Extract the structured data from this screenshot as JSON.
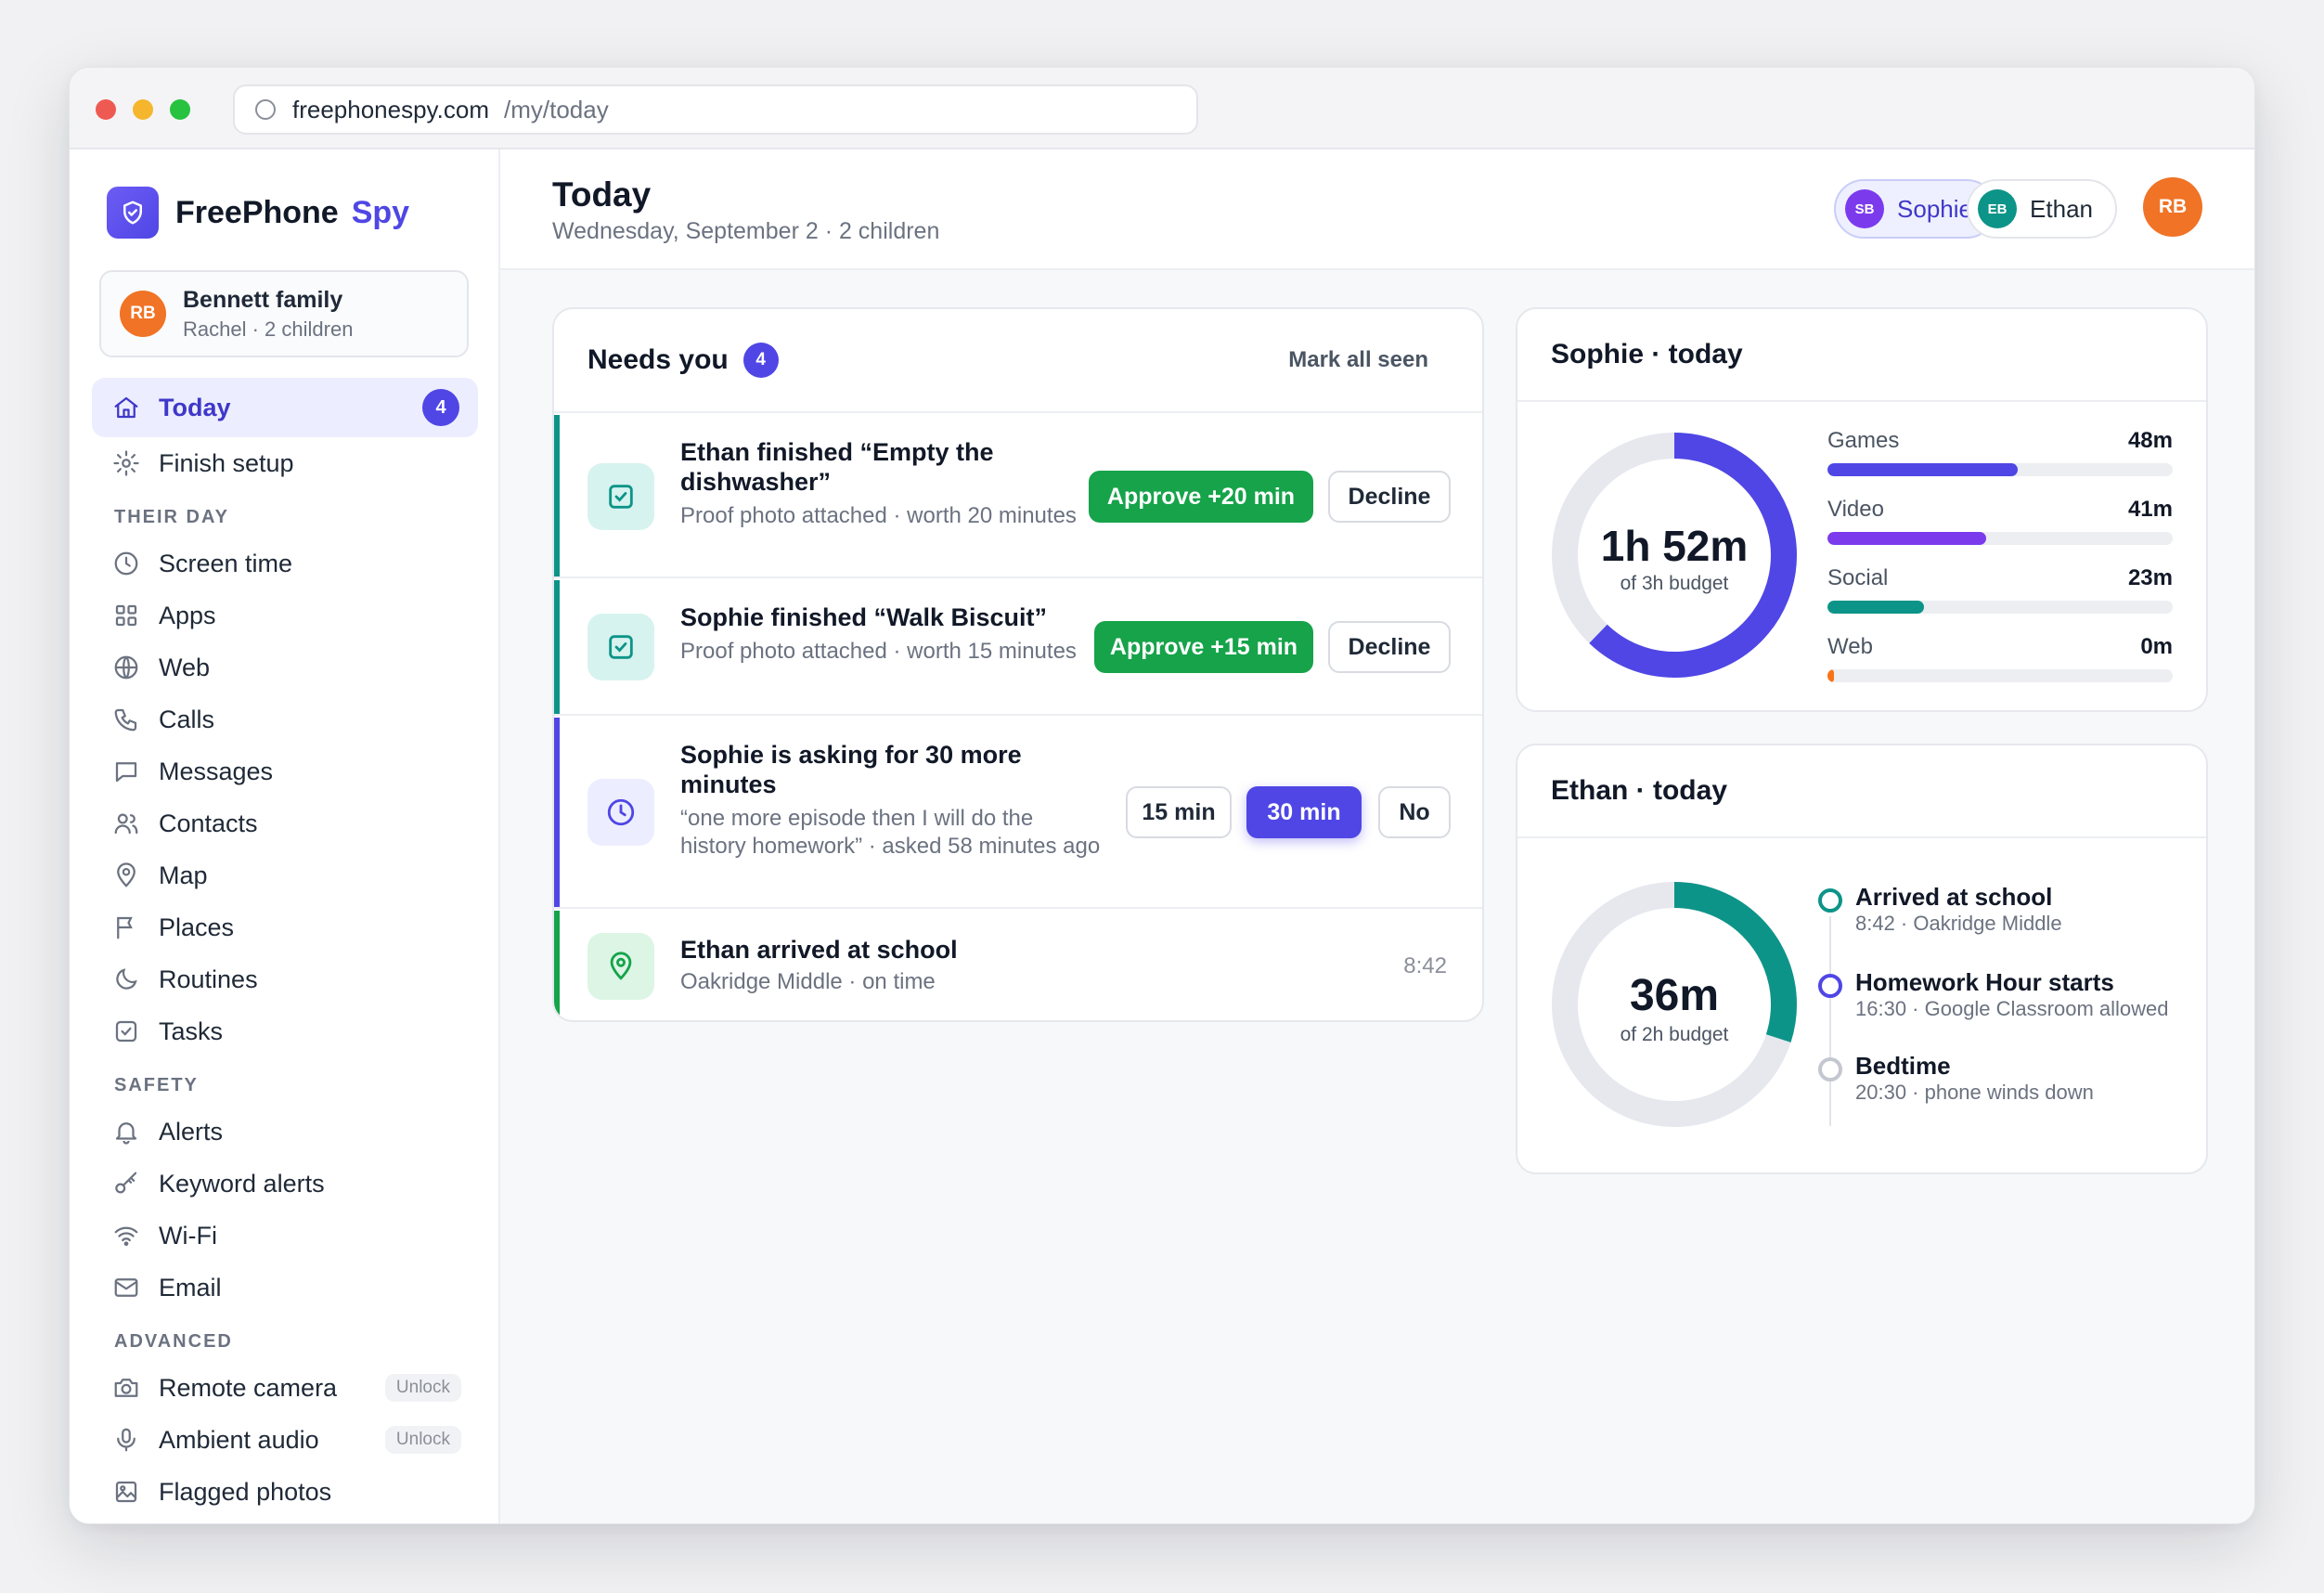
{
  "browser": {
    "host": "freephonespy.com",
    "path": "/my/today"
  },
  "brand": {
    "name": "FreePhone",
    "accent": "Spy"
  },
  "family": {
    "initials": "RB",
    "name": "Bennett family",
    "sub": "Rachel · 2 children"
  },
  "nav": {
    "today": {
      "label": "Today",
      "badge": "4"
    },
    "finish": {
      "label": "Finish setup"
    },
    "section_day": "THEIR DAY",
    "screen_time": "Screen time",
    "apps": "Apps",
    "web": "Web",
    "calls": "Calls",
    "messages": "Messages",
    "contacts": "Contacts",
    "map": "Map",
    "places": "Places",
    "routines": "Routines",
    "tasks": "Tasks",
    "section_safety": "SAFETY",
    "alerts": "Alerts",
    "keyword_alerts": "Keyword alerts",
    "wifi": "Wi-Fi",
    "email": "Email",
    "section_advanced": "ADVANCED",
    "remote_camera": "Remote camera",
    "ambient_audio": "Ambient audio",
    "flagged_photos": "Flagged photos",
    "unlock": "Unlock"
  },
  "header": {
    "title": "Today",
    "subtitle": "Wednesday, September 2 · 2 children",
    "chips": [
      {
        "initials": "SB",
        "name": "Sophie",
        "color": "#7c3aed"
      },
      {
        "initials": "EB",
        "name": "Ethan",
        "color": "#0d9488"
      }
    ],
    "me": "RB"
  },
  "needs": {
    "title": "Needs you",
    "count": "4",
    "mark_all": "Mark all seen",
    "items": [
      {
        "title": "Ethan finished “Empty the dishwasher”",
        "sub": "Proof photo attached · worth 20 minutes",
        "approve": "Approve +20 min",
        "decline": "Decline"
      },
      {
        "title": "Sophie finished “Walk Biscuit”",
        "sub": "Proof photo attached · worth 15 minutes",
        "approve": "Approve +15 min",
        "decline": "Decline"
      },
      {
        "title": "Sophie is asking for 30 more minutes",
        "sub": "“one more episode then I will do the history homework” · asked 58 minutes ago",
        "opt1": "15 min",
        "opt2": "30 min",
        "opt3": "No"
      },
      {
        "title": "Ethan arrived at school",
        "sub": "Oakridge Middle · on time",
        "time": "8:42"
      }
    ]
  },
  "sophie": {
    "title": "Sophie · today",
    "total": "1h 52m",
    "budget": "of 3h budget",
    "used_fraction": 0.622,
    "categories": [
      {
        "label": "Games",
        "value": "48m",
        "fraction": 0.55,
        "color": "#4f46e5"
      },
      {
        "label": "Video",
        "value": "41m",
        "fraction": 0.46,
        "color": "#7c3aed"
      },
      {
        "label": "Social",
        "value": "23m",
        "fraction": 0.28,
        "color": "#0d9488"
      },
      {
        "label": "Web",
        "value": "0m",
        "fraction": 0.02,
        "color": "#f97316"
      }
    ]
  },
  "ethan": {
    "title": "Ethan · today",
    "total": "36m",
    "budget": "of 2h budget",
    "used_fraction": 0.3,
    "timeline": [
      {
        "title": "Arrived at school",
        "sub": "8:42 · Oakridge Middle",
        "color": "#0d9488"
      },
      {
        "title": "Homework Hour starts",
        "sub": "16:30 · Google Classroom allowed",
        "color": "#4f46e5"
      },
      {
        "title": "Bedtime",
        "sub": "20:30 · phone winds down",
        "color": "#c4c7cf"
      }
    ]
  }
}
